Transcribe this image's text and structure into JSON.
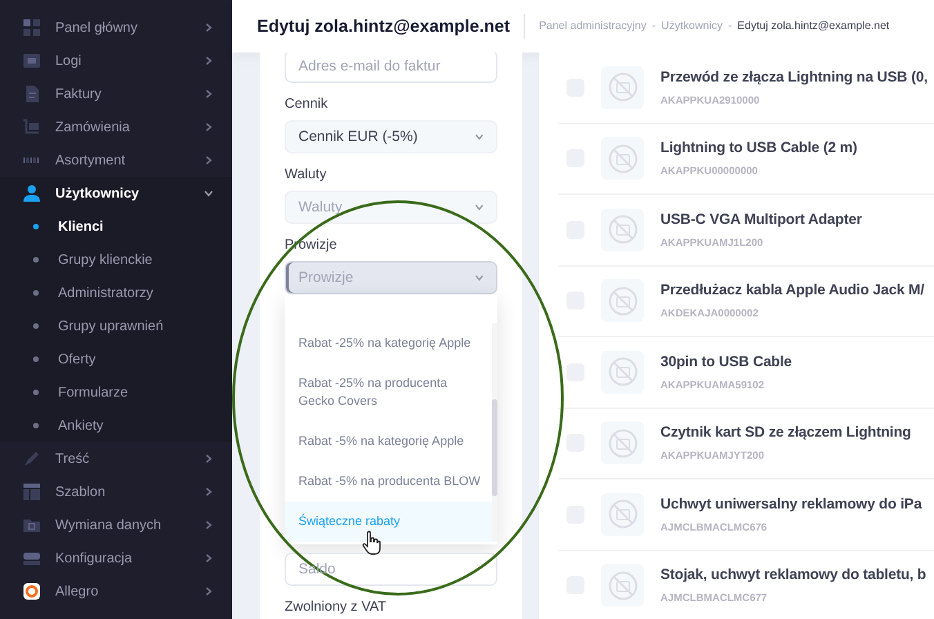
{
  "sidebar": {
    "items": [
      {
        "label": "Panel główny",
        "selected": false,
        "expanded": false
      },
      {
        "label": "Logi",
        "selected": false,
        "expanded": false
      },
      {
        "label": "Faktury",
        "selected": false,
        "expanded": false
      },
      {
        "label": "Zamówienia",
        "selected": false,
        "expanded": false
      },
      {
        "label": "Asortyment",
        "selected": false,
        "expanded": false
      },
      {
        "label": "Użytkownicy",
        "selected": true,
        "expanded": true,
        "children": [
          {
            "label": "Klienci",
            "selected": true
          },
          {
            "label": "Grupy klienckie",
            "selected": false
          },
          {
            "label": "Administratorzy",
            "selected": false
          },
          {
            "label": "Grupy uprawnień",
            "selected": false
          },
          {
            "label": "Oferty",
            "selected": false
          },
          {
            "label": "Formularze",
            "selected": false
          },
          {
            "label": "Ankiety",
            "selected": false
          }
        ]
      },
      {
        "label": "Treść",
        "selected": false,
        "expanded": false
      },
      {
        "label": "Szablon",
        "selected": false,
        "expanded": false
      },
      {
        "label": "Wymiana danych",
        "selected": false,
        "expanded": false
      },
      {
        "label": "Konfiguracja",
        "selected": false,
        "expanded": false
      },
      {
        "label": "Allegro",
        "selected": false,
        "expanded": false
      }
    ]
  },
  "header": {
    "title": "Edytuj zola.hintz@example.net",
    "breadcrumb": [
      "Panel administracyjny",
      "Użytkownicy",
      "Edytuj zola.hintz@example.net"
    ],
    "breadcrumb_separators": [
      "-",
      "-"
    ]
  },
  "form": {
    "email_field": {
      "placeholder": "Adres e-mail do faktur"
    },
    "fields": [
      {
        "label": "Cennik",
        "value": "Cennik EUR (-5%)",
        "focused": false
      },
      {
        "label": "Waluty",
        "placeholder": "Waluty",
        "focused": false
      },
      {
        "label": "Prowizje",
        "placeholder": "Prowizje",
        "focused": true
      }
    ],
    "dropdown": [
      {
        "label": "Rabat -25% na kategorię Apple",
        "highlighted": false
      },
      {
        "label": "Rabat -25% na producenta Gecko Covers",
        "highlighted": false
      },
      {
        "label": "Rabat -5% na kategorię Apple",
        "highlighted": false
      },
      {
        "label": "Rabat -5% na producenta BLOW",
        "highlighted": false
      },
      {
        "label": "Świąteczne rabaty",
        "highlighted": true
      }
    ],
    "saldo_field": {
      "placeholder": "Saldo"
    },
    "next_label": "Zwolniony z VAT"
  },
  "products": [
    {
      "name": "Przewód ze złącza Lightning na USB (0,",
      "code": "AKAPPKUA2910000",
      "checked": false
    },
    {
      "name": "Lightning to USB Cable (2 m)",
      "code": "AKAPPKU00000000",
      "checked": false
    },
    {
      "name": "USB-C VGA Multiport Adapter",
      "code": "AKAPPKUAMJ1L200",
      "checked": false
    },
    {
      "name": "Przedłużacz kabla Apple Audio Jack M/",
      "code": "AKDEKAJA0000002",
      "checked": false
    },
    {
      "name": "30pin to USB Cable",
      "code": "AKAPPKUAMA59102",
      "checked": false
    },
    {
      "name": "Czytnik kart SD ze złączem Lightning",
      "code": "AKAPPKUAMJYT200",
      "checked": false
    },
    {
      "name": "Uchwyt uniwersalny reklamowy do iPa",
      "code": "AJMCLBMACLMC676",
      "checked": false
    },
    {
      "name": "Stojak, uchwyt reklamowy do tabletu, b",
      "code": "AJMCLBMACLMC677",
      "checked": false
    }
  ]
}
